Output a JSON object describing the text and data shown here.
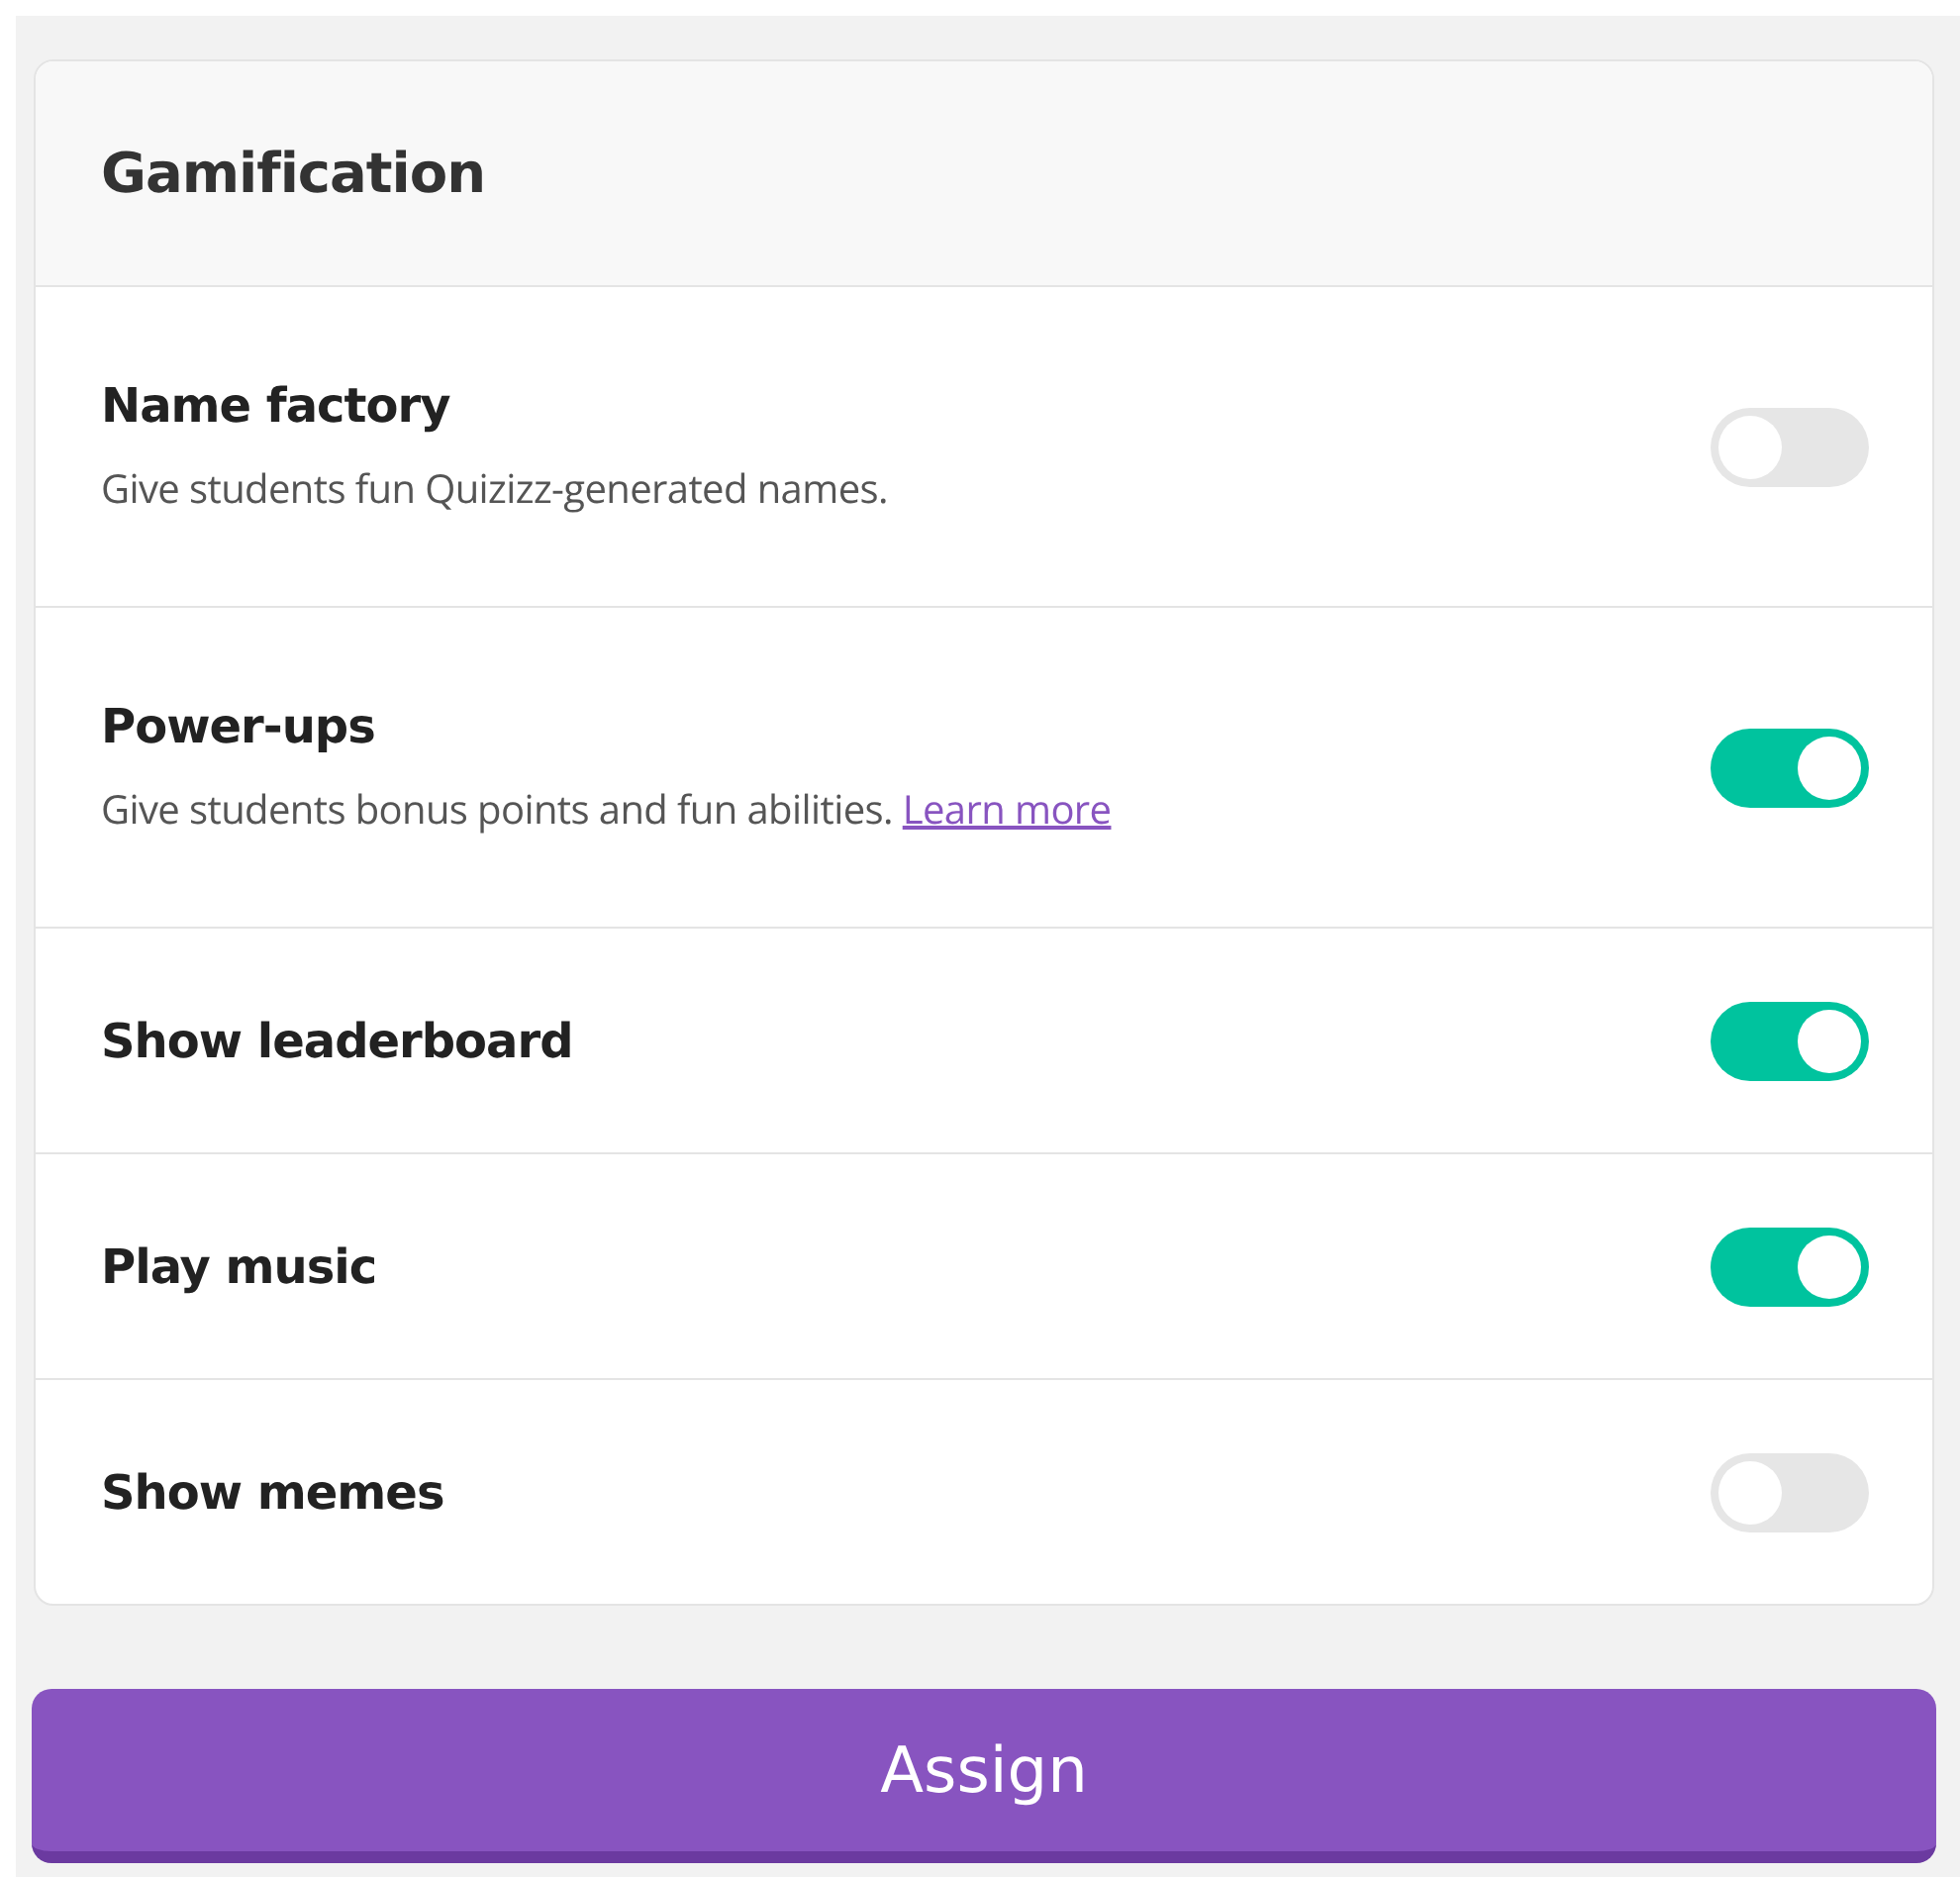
{
  "section": {
    "title": "Gamification"
  },
  "settings": [
    {
      "title": "Name factory",
      "description": "Give students fun Quizizz-generated names.",
      "on": false
    },
    {
      "title": "Power-ups",
      "description": "Give students bonus points and fun abilities.",
      "link": "Learn more",
      "on": true
    },
    {
      "title": "Show leaderboard",
      "on": true
    },
    {
      "title": "Play music",
      "on": true
    },
    {
      "title": "Show memes",
      "on": false
    }
  ],
  "assign_button": "Assign"
}
